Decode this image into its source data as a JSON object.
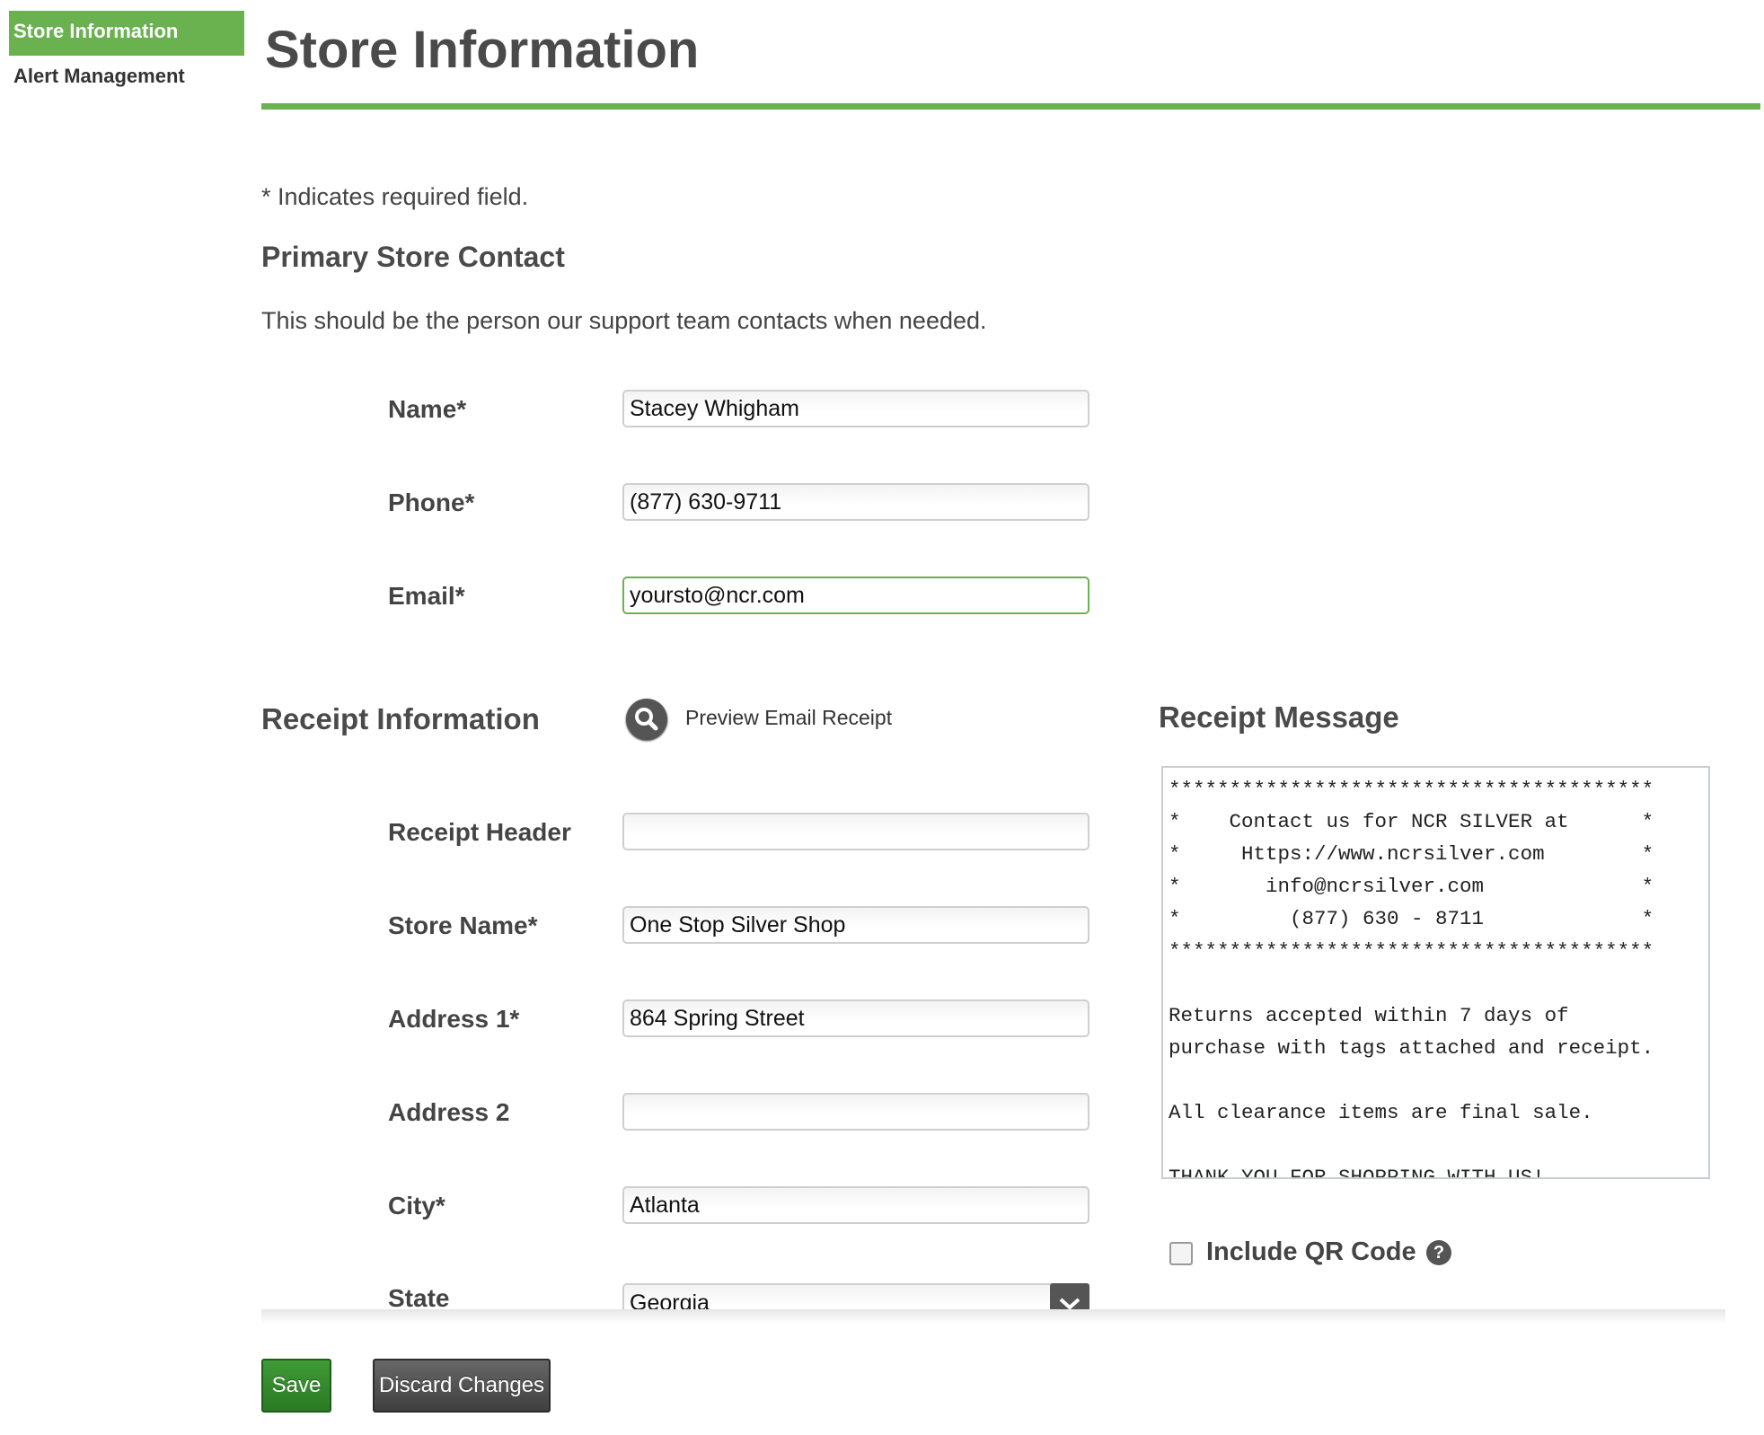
{
  "sidebar": {
    "items": [
      {
        "label": "Store Information",
        "active": true
      },
      {
        "label": "Alert Management",
        "active": false
      }
    ]
  },
  "header": {
    "title": "Store Information"
  },
  "required_note": "* Indicates required field.",
  "primary_contact": {
    "heading": "Primary Store Contact",
    "description": "This should be the person our support team contacts when needed.",
    "fields": {
      "name": {
        "label": "Name*",
        "value": "Stacey Whigham"
      },
      "phone": {
        "label": "Phone*",
        "value": "(877) 630-9711"
      },
      "email": {
        "label": "Email*",
        "value": "yoursto@ncr.com"
      }
    }
  },
  "receipt_info": {
    "heading": "Receipt Information",
    "preview_label": "Preview Email Receipt",
    "fields": {
      "receipt_header": {
        "label": "Receipt Header",
        "value": ""
      },
      "store_name": {
        "label": "Store Name*",
        "value": "One Stop Silver Shop"
      },
      "address1": {
        "label": "Address 1*",
        "value": "864 Spring Street"
      },
      "address2": {
        "label": "Address 2",
        "value": ""
      },
      "city": {
        "label": "City*",
        "value": "Atlanta"
      },
      "state": {
        "label": "State",
        "value": "Georgia"
      }
    }
  },
  "receipt_message": {
    "heading": "Receipt Message",
    "text": "****************************************\n*    Contact us for NCR SILVER at      *\n*     Https://www.ncrsilver.com        *\n*       info@ncrsilver.com             *\n*         (877) 630 - 8711             *\n****************************************\n\nReturns accepted within 7 days of\npurchase with tags attached and receipt.\n\nAll clearance items are final sale.\n\nTHANK YOU FOR SHOPPING WITH US!"
  },
  "qr": {
    "label": "Include QR Code",
    "checked": false,
    "help_glyph": "?"
  },
  "actions": {
    "save_label": "Save",
    "discard_label": "Discard Changes"
  },
  "colors": {
    "accent": "#6ab150",
    "save": "#2f8a2a",
    "discard": "#4a4a4a"
  }
}
